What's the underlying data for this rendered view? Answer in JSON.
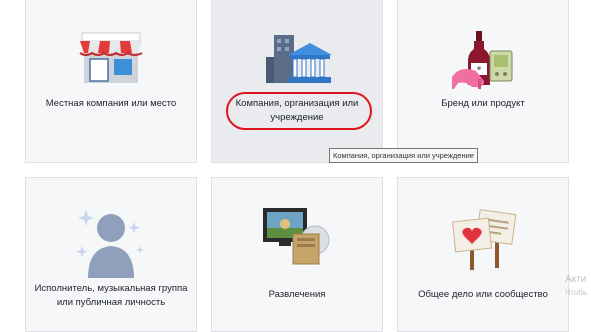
{
  "categories": [
    {
      "label": "Местная компания или место",
      "icon": "storefront-icon"
    },
    {
      "label": "Компания, организация или учреждение",
      "icon": "buildings-icon"
    },
    {
      "label": "Бренд или продукт",
      "icon": "products-icon"
    },
    {
      "label": "Исполнитель, музыкальная группа или публичная личность",
      "icon": "person-silhouette-icon"
    },
    {
      "label": "Развлечения",
      "icon": "tv-movie-icon"
    },
    {
      "label": "Общее дело или сообщество",
      "icon": "protest-signs-icon"
    }
  ],
  "tooltip": "Компания, организация или учреждение",
  "watermark": {
    "line1": "Акти",
    "line2": "Чтобь"
  },
  "colors": {
    "highlight": "#e0141e",
    "card_bg": "#f6f7f9",
    "card_hover_bg": "#e9ebee"
  }
}
